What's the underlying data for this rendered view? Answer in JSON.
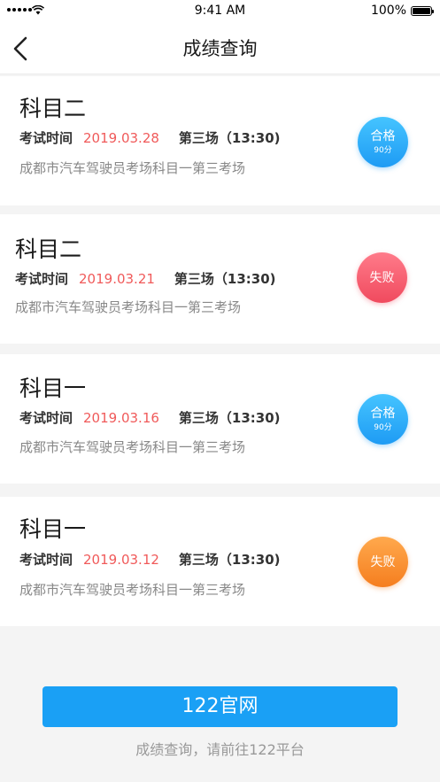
{
  "status_bar": {
    "time": "9:41 AM",
    "battery": "100%"
  },
  "nav": {
    "title": "成绩查询"
  },
  "records": [
    {
      "subject": "科目二",
      "label": "考试时间",
      "date": "2019.03.28",
      "session": "第三场（13:30)",
      "location": "成都市汽车驾驶员考场科目一第三考场",
      "result": "合格",
      "score": "90分"
    },
    {
      "subject": "科目二",
      "label": "考试时间",
      "date": "2019.03.21",
      "session": "第三场（13:30)",
      "location": "成都市汽车驾驶员考场科目一第三考场",
      "result": "失败",
      "score": ""
    },
    {
      "subject": "科目一",
      "label": "考试时间",
      "date": "2019.03.16",
      "session": "第三场（13:30)",
      "location": "成都市汽车驾驶员考场科目一第三考场",
      "result": "合格",
      "score": "90分"
    },
    {
      "subject": "科目一",
      "label": "考试时间",
      "date": "2019.03.12",
      "session": "第三场（13:30)",
      "location": "成都市汽车驾驶员考场科目一第三考场",
      "result": "失败",
      "score": ""
    }
  ],
  "footer": {
    "button_label": "122官网",
    "hint": "成绩查询，请前往122平台"
  },
  "colors": {
    "accent": "#1aa0f5",
    "date_red": "#f05a5a",
    "pass": "#2aaaf8",
    "fail_red": "#f25a6c",
    "fail_orange": "#f78a2e"
  }
}
